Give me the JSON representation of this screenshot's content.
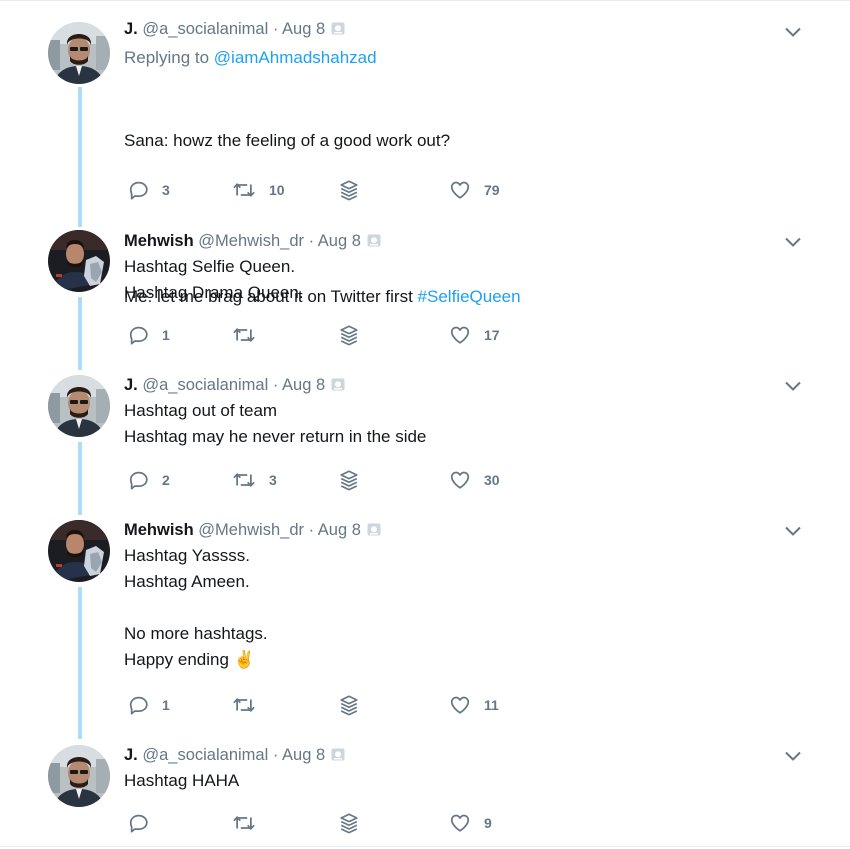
{
  "tweets": [
    {
      "name": "J.",
      "handle": "@a_socialanimal",
      "time": "Aug 8",
      "reply_prefix": "Replying to ",
      "reply_to": "@iamAhmadshahzad",
      "text_line1": "Sana: howz the feeling of a good work out?",
      "text_line2": "Me: let me brag about it on Twitter first ",
      "hashtag": "#SelfieQueen",
      "replies": "3",
      "retweets": "10",
      "likes": "79"
    },
    {
      "name": "Mehwish",
      "handle": "@Mehwish_dr",
      "time": "Aug 8",
      "text": "Hashtag Selfie Queen.\nHashtag Drama Queen.",
      "replies": "1",
      "retweets": "",
      "likes": "17"
    },
    {
      "name": "J.",
      "handle": "@a_socialanimal",
      "time": "Aug 8",
      "text": "Hashtag out of team\nHashtag may he never return in the side",
      "replies": "2",
      "retweets": "3",
      "likes": "30"
    },
    {
      "name": "Mehwish",
      "handle": "@Mehwish_dr",
      "time": "Aug 8",
      "text": "Hashtag Yassss.\nHashtag Ameen.\n\nNo more hashtags.\nHappy ending ✌",
      "replies": "1",
      "retweets": "",
      "likes": "11"
    },
    {
      "name": "J.",
      "handle": "@a_socialanimal",
      "time": "Aug 8",
      "text": "Hashtag HAHA",
      "replies": "",
      "retweets": "",
      "likes": "9"
    }
  ],
  "separator": "·",
  "colors": {
    "link": "#1da1f2",
    "muted": "#657786",
    "thread": "#b1dcf7"
  },
  "icons": {
    "reply": "reply-icon",
    "retweet": "retweet-icon",
    "stack": "stack-icon",
    "like": "heart-icon",
    "caret": "chevron-down-icon",
    "verified": "badge-icon"
  }
}
